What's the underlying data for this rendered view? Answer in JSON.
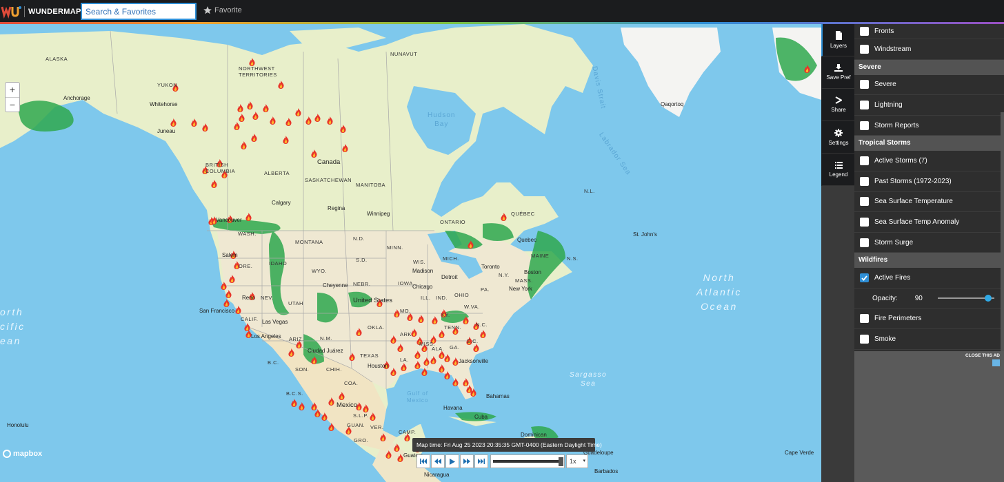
{
  "app": {
    "logo_text": "WUNDERMAP"
  },
  "search": {
    "placeholder": "Search & Favorites"
  },
  "favorite": {
    "label": "Favorite"
  },
  "rail": [
    {
      "label": "Layers",
      "icon": "layers-icon"
    },
    {
      "label": "Save Pref",
      "icon": "download-icon"
    },
    {
      "label": "Share",
      "icon": "share-icon"
    },
    {
      "label": "Settings",
      "icon": "gear-icon"
    },
    {
      "label": "Legend",
      "icon": "list-icon"
    }
  ],
  "layers": {
    "fronts": "Fronts",
    "windstream": "Windstream",
    "severe_section": "Severe",
    "severe": "Severe",
    "lightning": "Lightning",
    "storm_reports": "Storm Reports",
    "tropical_section": "Tropical Storms",
    "active_storms": "Active Storms (7)",
    "past_storms": "Past Storms (1972-2023)",
    "sst": "Sea Surface Temperature",
    "sst_anomaly": "Sea Surface Temp Anomaly",
    "storm_surge": "Storm Surge",
    "wildfires_section": "Wildfires",
    "active_fires": "Active Fires",
    "active_fires_checked": true,
    "opacity_label": "Opacity:",
    "opacity_value": "90",
    "opacity_fraction": 0.9,
    "fire_perimeters": "Fire Perimeters",
    "smoke": "Smoke"
  },
  "ad": {
    "close_label": "CLOSE THIS AD"
  },
  "time": {
    "label": "Map time: Fri Aug 25 2023 20:35:35 GMT-0400 (Eastern Daylight Time)",
    "speed": "1x",
    "progress_fraction": 1.0
  },
  "attribution": "mapbox",
  "map_labels": {
    "alaska": "ALASKA",
    "yukon": "YUKON",
    "nwt": "NORTHWEST\nTERRITORIES",
    "nunavut": "NUNAVUT",
    "bc": "BRITISH\nCOLUMBIA",
    "alberta": "ALBERTA",
    "sask": "SASKATCHEWAN",
    "manitoba": "MANITOBA",
    "ontario": "ONTARIO",
    "quebec_prov": "QUÉBEC",
    "nl": "N.L.",
    "ns": "N.S.",
    "canada": "Canada",
    "us": "United States",
    "mexico": "Mexico",
    "cuba": "Cuba",
    "bahamas": "Bahamas",
    "hudson": "Hudson\nBay",
    "davis": "Davis Strait",
    "labrador": "Labrador Sea",
    "gulf": "Gulf of\nMexico",
    "sargasso": "Sargasso\nSea",
    "north_atlantic": "North\nAtlantic\nOcean",
    "north_pacific": "orth\ncific\nean",
    "anchorage": "Anchorage",
    "whitehorse": "Whitehorse",
    "juneau": "Juneau",
    "calgary": "Calgary",
    "regina": "Regina",
    "winnipeg": "Winnipeg",
    "vancouver": "Vancouver",
    "qaqortoq": "Qaqortoq",
    "stjohns": "St. John's",
    "quebec_city": "Quebec",
    "toronto": "Toronto",
    "chicago": "Chicago",
    "detroit": "Detroit",
    "madison": "Madison",
    "boston": "Boston",
    "new_york": "New York",
    "cheyenne": "Cheyenne",
    "reno": "Reno",
    "sanfrancisco": "San Francisco",
    "lasvegas": "Las Vegas",
    "losangeles": "Los Angeles",
    "salem": "Salem",
    "houston": "Houston",
    "jacksonville": "Jacksonville",
    "ciudadjuarez": "Ciudad Juárez",
    "havana": "Havana",
    "honolulu": "Honolulu",
    "nicaragua": "Nicaragua",
    "guatemala": "Guatem",
    "dominican": "Dominican",
    "guadeloupe": "Guadeloupe",
    "barbados": "Barbados",
    "capeverde": "Cape Verde",
    "wash": "WASH.",
    "ore": "ORE.",
    "idaho": "IDAHO",
    "montana": "MONTANA",
    "wyo": "WYO.",
    "nev": "NEV.",
    "utah": "UTAH",
    "calif": "CALIF.",
    "ariz": "ARIZ.",
    "nm": "N.M.",
    "texas": "TEXAS",
    "okla": "OKLA.",
    "nebr": "NEBR.",
    "sd": "S.D.",
    "nd": "N.D.",
    "minn": "MINN.",
    "wis": "WIS.",
    "mich": "MICH.",
    "iowa": "IOWA",
    "ill": "ILL.",
    "ind": "IND.",
    "ohio": "OHIO",
    "pa": "PA.",
    "ny": "N.Y.",
    "maine": "MAINE",
    "mass": "MASS.",
    "wva": "W.VA.",
    "ky": "KY.",
    "tenn": "TENN.",
    "nc": "N.C.",
    "sc": "S.C.",
    "ark": "ARK.",
    "miss": "MISS.",
    "ala": "ALA.",
    "ga": "GA.",
    "la": "LA.",
    "mo": "MO.",
    "bc_mx": "B.C.",
    "son": "SON.",
    "chih": "CHIH.",
    "coa": "COA.",
    "bcs": "B.C.S.",
    "slp": "S.L.P.",
    "guan": "GUAN.",
    "gro": "GRO.",
    "camp": "CAMP.",
    "ver": "VER."
  }
}
